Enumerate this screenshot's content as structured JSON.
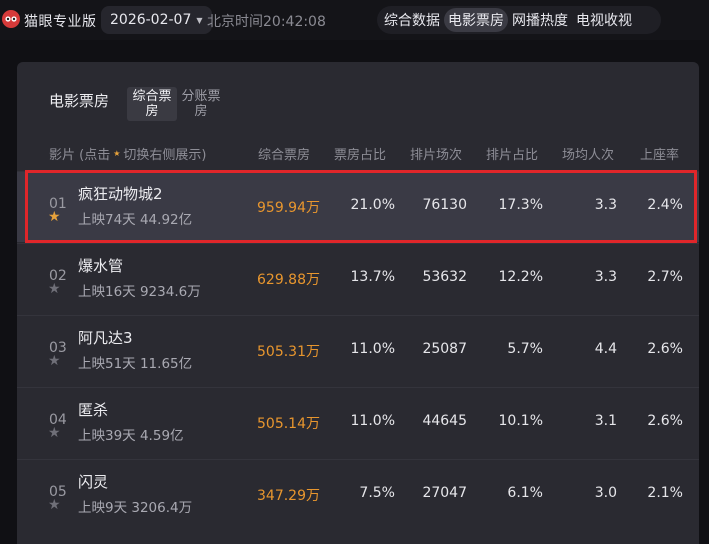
{
  "app": {
    "name": "猫眼专业版"
  },
  "header": {
    "date": "2026-02-07",
    "clock": "北京时间20:42:08",
    "nav": [
      {
        "label": "综合数据",
        "active": false
      },
      {
        "label": "电影票房",
        "active": true
      },
      {
        "label": "网播热度",
        "active": false
      },
      {
        "label": "电视收视",
        "active": false
      }
    ]
  },
  "panel": {
    "title": "电影票房",
    "subtabs": [
      {
        "line1": "综合票",
        "line2": "房",
        "active": true
      },
      {
        "line1": "分账票",
        "line2": "房",
        "active": false
      }
    ]
  },
  "table": {
    "columns": {
      "film_prefix": "影片 (点击",
      "film_suffix": "切换右侧展示)",
      "box": "综合票房",
      "box_share": "票房占比",
      "screenings": "排片场次",
      "screen_share": "排片占比",
      "avg_people": "场均人次",
      "occupancy": "上座率"
    },
    "rows": [
      {
        "rank": "01",
        "name": "疯狂动物城2",
        "meta": "上映74天  44.92亿",
        "box": "959.94万",
        "box_share": "21.0%",
        "screenings": "76130",
        "screen_share": "17.3%",
        "avg_people": "3.3",
        "occupancy": "2.4%",
        "starred": true
      },
      {
        "rank": "02",
        "name": "爆水管",
        "meta": "上映16天  9234.6万",
        "box": "629.88万",
        "box_share": "13.7%",
        "screenings": "53632",
        "screen_share": "12.2%",
        "avg_people": "3.3",
        "occupancy": "2.7%",
        "starred": false
      },
      {
        "rank": "03",
        "name": "阿凡达3",
        "meta": "上映51天  11.65亿",
        "box": "505.31万",
        "box_share": "11.0%",
        "screenings": "25087",
        "screen_share": "5.7%",
        "avg_people": "4.4",
        "occupancy": "2.6%",
        "starred": false
      },
      {
        "rank": "04",
        "name": "匿杀",
        "meta": "上映39天  4.59亿",
        "box": "505.14万",
        "box_share": "11.0%",
        "screenings": "44645",
        "screen_share": "10.1%",
        "avg_people": "3.1",
        "occupancy": "2.6%",
        "starred": false
      },
      {
        "rank": "05",
        "name": "闪灵",
        "meta": "上映9天  3206.4万",
        "box": "347.29万",
        "box_share": "7.5%",
        "screenings": "27047",
        "screen_share": "6.1%",
        "avg_people": "3.0",
        "occupancy": "2.1%",
        "starred": false
      }
    ]
  },
  "colors": {
    "accent_orange": "#e8962e",
    "highlight_frame": "#e0262a",
    "logo_red": "#d63a3a"
  }
}
